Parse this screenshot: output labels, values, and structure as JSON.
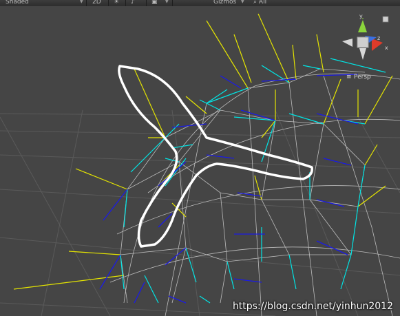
{
  "toolbar": {
    "shading_mode": "Shaded",
    "mode_2d": "2D",
    "lighting_icon": "sun-icon",
    "audio_icon": "speaker-icon",
    "effects_icon": "image-icon",
    "gizmos_label": "Gizmos",
    "search_placeholder": "All"
  },
  "scene_gizmo": {
    "projection_label": "Persp",
    "axis_y": "y",
    "axis_x": "x",
    "axis_z": "z",
    "colors": {
      "y": "#8bd43c",
      "x": "#e03b2a",
      "z": "#3b6fe0",
      "center": "#cfcfcf"
    }
  },
  "scene": {
    "background": "#454545",
    "colors": {
      "normals": "#00e5e5",
      "tangents": "#1a1ae8",
      "binormals": "#e5e500",
      "wire": "#c8c8c8",
      "selection": "#ffffff"
    }
  },
  "watermark": "https://blog.csdn.net/yinhun2012"
}
